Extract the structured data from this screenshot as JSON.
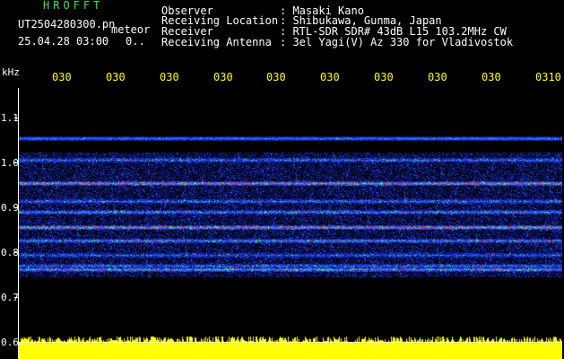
{
  "header": {
    "brand": "HROFFT",
    "filename": "UT2504280300.pn",
    "label_meteor": "meteor",
    "datetime": "25.04.28 03:00",
    "counter": "0..",
    "fields": [
      {
        "label": "Observer",
        "value": ": Masaki Kano"
      },
      {
        "label": "Receiving Location",
        "value": ": Shibukawa, Gunma, Japan"
      },
      {
        "label": "Receiver",
        "value": ": RTL-SDR SDR# 43dB L15 103.2MHz CW"
      },
      {
        "label": "Receiving Antenna",
        "value": ": 3el Yagi(V) Az 330 for Vladivostok"
      }
    ]
  },
  "axis": {
    "unit": "kHz",
    "y_labels": [
      "1.1",
      "1.0",
      "0.9",
      "0.8",
      "0.7",
      "0.6"
    ],
    "x_labels": [
      "030",
      "030",
      "030",
      "030",
      "030",
      "030",
      "030",
      "030",
      "030",
      "0310"
    ]
  },
  "colors": {
    "background": "#000000",
    "text": "#ffffff",
    "brand": "#3ee34a",
    "ticks": "#ffff00",
    "noise_low": "#0a1a8c",
    "noise_mid": "#2a5cff",
    "signal_green": "#3cff6a",
    "signal_red": "#ff2a3a",
    "power_band": "#ffff00"
  }
}
